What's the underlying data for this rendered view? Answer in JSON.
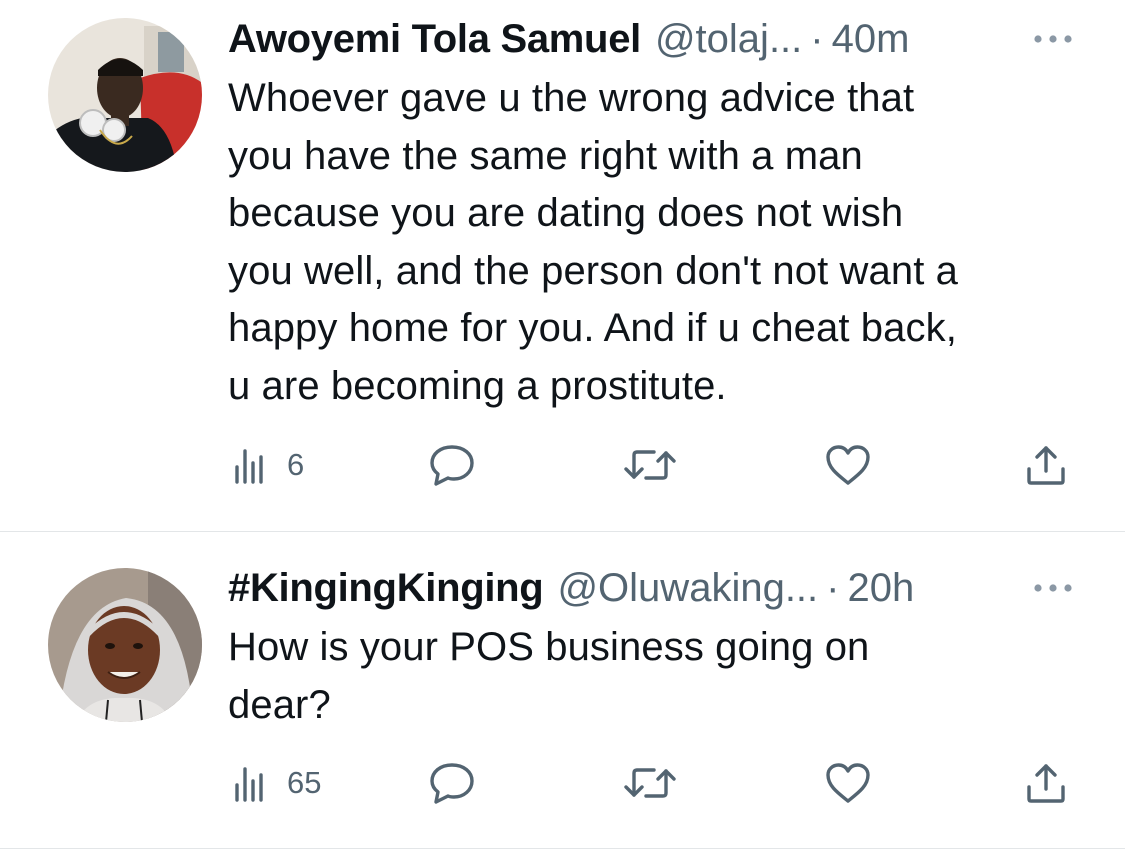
{
  "tweets": [
    {
      "display_name": "Awoyemi Tola Samuel",
      "handle": "@tolaj...",
      "separator": "·",
      "time": "40m",
      "text": "Whoever gave u the wrong advice that\nyou have the same right with a man\nbecause you are dating does not wish\nyou well, and the person don't not want a\nhappy home for you. And if u cheat back,\nu are becoming a prostitute.",
      "views": "6",
      "icons": [
        "views-icon",
        "reply-icon",
        "retweet-icon",
        "like-icon",
        "share-icon",
        "more-icon"
      ]
    },
    {
      "display_name": "#KingingKinging",
      "handle": "@Oluwaking...",
      "separator": "·",
      "time": "20h",
      "text": "How is your POS business going on\ndear?",
      "views": "65",
      "icons": [
        "views-icon",
        "reply-icon",
        "retweet-icon",
        "like-icon",
        "share-icon",
        "more-icon"
      ]
    }
  ],
  "colors": {
    "text_primary": "#0f1419",
    "text_secondary": "#536471",
    "divider": "#e3e6e8",
    "background": "#ffffff"
  }
}
